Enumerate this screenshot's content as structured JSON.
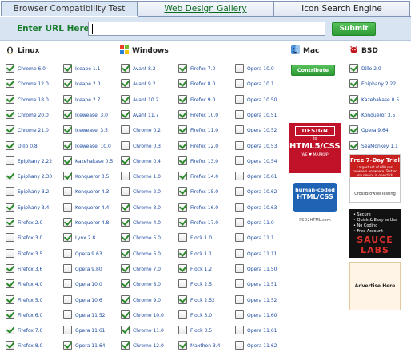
{
  "tabs": [
    {
      "label": "Browser Compatibility Test"
    },
    {
      "label": "Web Design Gallery"
    },
    {
      "label": "Icon Search Engine"
    }
  ],
  "url_bar": {
    "label": "Enter URL Here:",
    "value": "",
    "submit_label": "Submit"
  },
  "os_headers": {
    "linux": "Linux",
    "windows": "Windows",
    "mac": "Mac",
    "bsd": "BSD"
  },
  "mac": {
    "contribute_label": "Contribute"
  },
  "columns": {
    "linux1": [
      {
        "name": "Chrome 6.0",
        "checked": true
      },
      {
        "name": "Chrome 12.0",
        "checked": true
      },
      {
        "name": "Chrome 18.0",
        "checked": true
      },
      {
        "name": "Chrome 20.0",
        "checked": true
      },
      {
        "name": "Chrome 21.0",
        "checked": true
      },
      {
        "name": "Dillo 0.8",
        "checked": true
      },
      {
        "name": "Epiphany 2.22",
        "checked": false
      },
      {
        "name": "Epiphany 2.30",
        "checked": true
      },
      {
        "name": "Epiphany 3.2",
        "checked": false
      },
      {
        "name": "Epiphany 3.4",
        "checked": true
      },
      {
        "name": "Firefox 2.0",
        "checked": true
      },
      {
        "name": "Firefox 3.0",
        "checked": false
      },
      {
        "name": "Firefox 3.5",
        "checked": false
      },
      {
        "name": "Firefox 3.6",
        "checked": true
      },
      {
        "name": "Firefox 4.0",
        "checked": true
      },
      {
        "name": "Firefox 5.0",
        "checked": true
      },
      {
        "name": "Firefox 6.0",
        "checked": true
      },
      {
        "name": "Firefox 7.0",
        "checked": true
      },
      {
        "name": "Firefox 8.0",
        "checked": true
      }
    ],
    "linux2": [
      {
        "name": "Iceape 1.1",
        "checked": true
      },
      {
        "name": "Iceape 2.0",
        "checked": true
      },
      {
        "name": "Iceape 2.7",
        "checked": true
      },
      {
        "name": "Iceweasel 3.0",
        "checked": true
      },
      {
        "name": "Iceweasel 3.5",
        "checked": true
      },
      {
        "name": "Iceweasel 10.0",
        "checked": true
      },
      {
        "name": "Kazehakase 0.5",
        "checked": true
      },
      {
        "name": "Konqueror 3.5",
        "checked": true
      },
      {
        "name": "Konqueror 4.3",
        "checked": false
      },
      {
        "name": "Konqueror 4.4",
        "checked": false
      },
      {
        "name": "Konqueror 4.8",
        "checked": true
      },
      {
        "name": "Lynx 2.8",
        "checked": true
      },
      {
        "name": "Opera 9.63",
        "checked": false
      },
      {
        "name": "Opera 9.80",
        "checked": false
      },
      {
        "name": "Opera 10.0",
        "checked": false
      },
      {
        "name": "Opera 10.6",
        "checked": false
      },
      {
        "name": "Opera 11.52",
        "checked": false
      },
      {
        "name": "Opera 11.61",
        "checked": false
      },
      {
        "name": "Opera 11.64",
        "checked": true
      }
    ],
    "win1": [
      {
        "name": "Avant 8.2",
        "checked": true
      },
      {
        "name": "Avant 9.2",
        "checked": true
      },
      {
        "name": "Avant 10.2",
        "checked": true
      },
      {
        "name": "Avant 11.7",
        "checked": true
      },
      {
        "name": "Chrome 0.2",
        "checked": false
      },
      {
        "name": "Chrome 0.3",
        "checked": false
      },
      {
        "name": "Chrome 0.4",
        "checked": true
      },
      {
        "name": "Chrome 1.0",
        "checked": false
      },
      {
        "name": "Chrome 2.0",
        "checked": false
      },
      {
        "name": "Chrome 3.0",
        "checked": true
      },
      {
        "name": "Chrome 4.0",
        "checked": true
      },
      {
        "name": "Chrome 5.0",
        "checked": true
      },
      {
        "name": "Chrome 6.0",
        "checked": true
      },
      {
        "name": "Chrome 7.0",
        "checked": true
      },
      {
        "name": "Chrome 8.0",
        "checked": true
      },
      {
        "name": "Chrome 9.0",
        "checked": true
      },
      {
        "name": "Chrome 10.0",
        "checked": true
      },
      {
        "name": "Chrome 11.0",
        "checked": true
      },
      {
        "name": "Chrome 12.0",
        "checked": true
      }
    ],
    "win2": [
      {
        "name": "Firefox 7.0",
        "checked": true
      },
      {
        "name": "Firefox 8.0",
        "checked": true
      },
      {
        "name": "Firefox 9.0",
        "checked": true
      },
      {
        "name": "Firefox 10.0",
        "checked": true
      },
      {
        "name": "Firefox 11.0",
        "checked": true
      },
      {
        "name": "Firefox 12.0",
        "checked": true
      },
      {
        "name": "Firefox 13.0",
        "checked": true
      },
      {
        "name": "Firefox 14.0",
        "checked": true
      },
      {
        "name": "Firefox 15.0",
        "checked": true
      },
      {
        "name": "Firefox 16.0",
        "checked": true
      },
      {
        "name": "Firefox 17.0",
        "checked": true
      },
      {
        "name": "Flock 1.0",
        "checked": false
      },
      {
        "name": "Flock 1.1",
        "checked": true
      },
      {
        "name": "Flock 1.2",
        "checked": true
      },
      {
        "name": "Flock 2.5",
        "checked": false
      },
      {
        "name": "Flock 2.52",
        "checked": true
      },
      {
        "name": "Flock 3.0",
        "checked": false
      },
      {
        "name": "Flock 3.5",
        "checked": false
      },
      {
        "name": "Maxthon 3.4",
        "checked": true
      }
    ],
    "win3": [
      {
        "name": "Opera 10.0",
        "checked": false
      },
      {
        "name": "Opera 10.1",
        "checked": false
      },
      {
        "name": "Opera 10.50",
        "checked": false
      },
      {
        "name": "Opera 10.51",
        "checked": false
      },
      {
        "name": "Opera 10.52",
        "checked": false
      },
      {
        "name": "Opera 10.53",
        "checked": false
      },
      {
        "name": "Opera 10.54",
        "checked": false
      },
      {
        "name": "Opera 10.61",
        "checked": false
      },
      {
        "name": "Opera 10.62",
        "checked": false
      },
      {
        "name": "Opera 10.63",
        "checked": false
      },
      {
        "name": "Opera 11.0",
        "checked": false
      },
      {
        "name": "Opera 11.1",
        "checked": false
      },
      {
        "name": "Opera 11.11",
        "checked": false
      },
      {
        "name": "Opera 11.50",
        "checked": false
      },
      {
        "name": "Opera 11.51",
        "checked": false
      },
      {
        "name": "Opera 11.52",
        "checked": false
      },
      {
        "name": "Opera 11.60",
        "checked": false
      },
      {
        "name": "Opera 11.61",
        "checked": false
      },
      {
        "name": "Opera 11.62",
        "checked": false
      }
    ],
    "bsd": [
      {
        "name": "Dillo 2.0",
        "checked": true
      },
      {
        "name": "Epiphany 2.22",
        "checked": true
      },
      {
        "name": "Kazehakase 0.5",
        "checked": true
      },
      {
        "name": "Konqueror 3.5",
        "checked": true
      },
      {
        "name": "Opera 9.64",
        "checked": true
      },
      {
        "name": "SeaMonkey 1.1",
        "checked": true
      }
    ]
  },
  "ads": {
    "design": {
      "line1": "DESIGN",
      "line2": "to",
      "line3": "HTML5/CSS3",
      "line4": "WE ♥ MARKUP"
    },
    "human": {
      "line1": "human-coded",
      "line2": "HTML/CSS",
      "site": "PSD2HTML.com"
    },
    "cbt": {
      "title": "Free 7-Day Trial",
      "sub": "Largest set of 600 real browsers anywhere. Test on any device in one click.",
      "brand": "CrossBrowserTesting"
    },
    "sauce": {
      "lines": [
        "• Secure",
        "• Quick & Easy to Use",
        "• No Coding",
        "• Free Account"
      ],
      "logo": "SAUCE LABS"
    },
    "here": {
      "label": "Advertise Here"
    }
  },
  "colors": {
    "accent_green": "#2d9a34",
    "link_blue": "#1c4aa0",
    "header_bg": "#d8e4f2"
  }
}
